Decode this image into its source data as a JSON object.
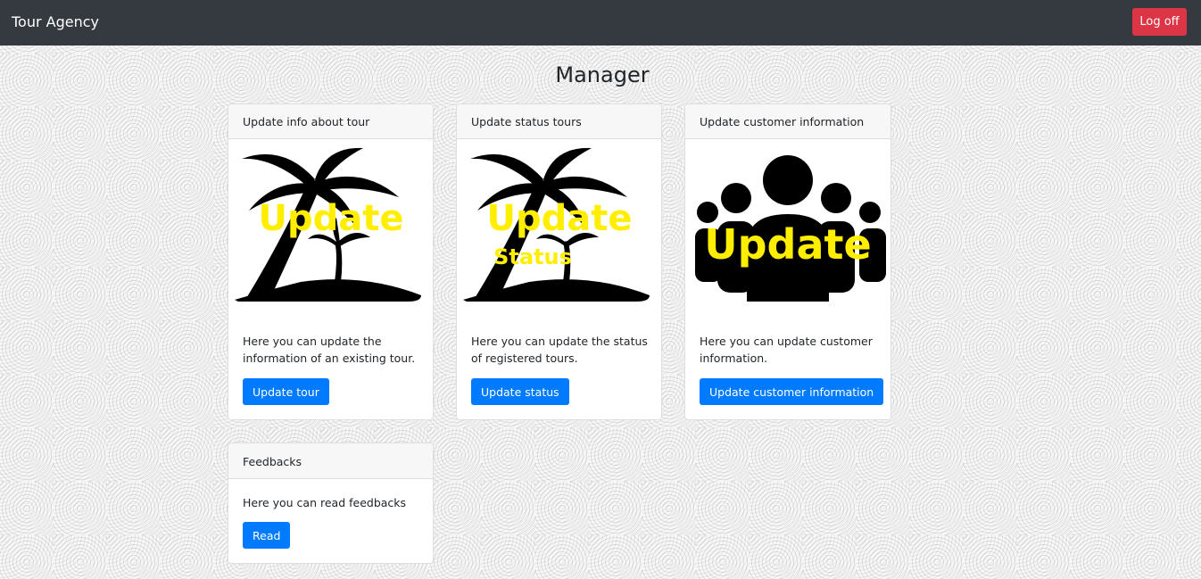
{
  "navbar": {
    "brand": "Tour Agency",
    "logoff_label": "Log off"
  },
  "page": {
    "title": "Manager"
  },
  "cards": [
    {
      "header": "Update info about tour",
      "image_text": "Update",
      "image_subtext": "",
      "text": "Here you can update the information of an existing tour.",
      "button": "Update tour"
    },
    {
      "header": "Update status tours",
      "image_text": "Update",
      "image_subtext": "Status",
      "text": "Here you can update the status of registered tours.",
      "button": "Update status"
    },
    {
      "header": "Update customer information",
      "image_text": "Update",
      "image_subtext": "",
      "text": "Here you can update customer information.",
      "button": "Update customer information"
    },
    {
      "header": "Feedbacks",
      "text": "Here you can read feedbacks",
      "button": "Read"
    }
  ],
  "colors": {
    "navbar": "#343a40",
    "danger": "#dc3545",
    "primary": "#007bff",
    "image_text": "#ffee00"
  }
}
